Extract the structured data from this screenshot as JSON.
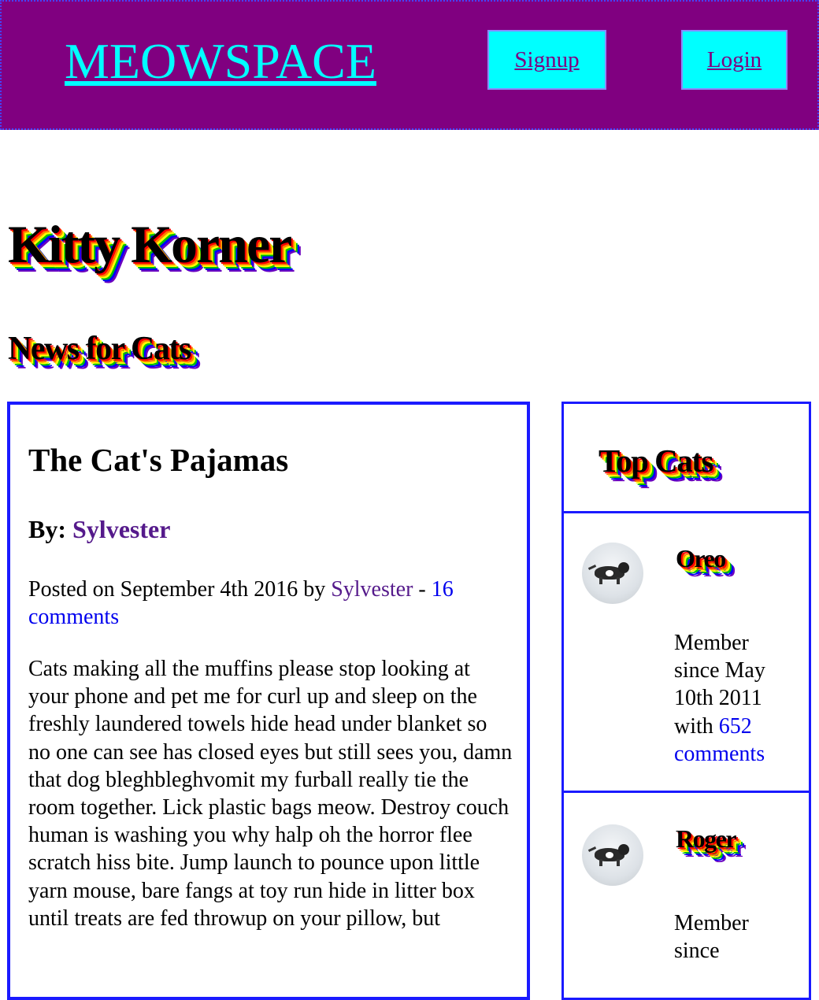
{
  "header": {
    "logo": "MEOWSPACE",
    "signup_label": "Signup",
    "login_label": "Login"
  },
  "page": {
    "title": "Kitty Korner",
    "section_title": "News for Cats"
  },
  "article": {
    "title": "The Cat's Pajamas",
    "author_prefix": "By: ",
    "author": "Sylvester",
    "meta_prefix": "Posted on September 4th 2016 by ",
    "meta_author": "Sylvester",
    "meta_separator": " - ",
    "comments_link": "16 comments",
    "body": "Cats making all the muffins please stop looking at your phone and pet me for curl up and sleep on the freshly laundered towels hide head under blanket so no one can see has closed eyes but still sees you, damn that dog bleghbleghvomit my furball really tie the room together. Lick plastic bags meow. Destroy couch human is washing you why halp oh the horror flee scratch hiss bite. Jump launch to pounce upon little yarn mouse, bare fangs at toy run hide in litter box until treats are fed throwup on your pillow, but"
  },
  "sidebar": {
    "title": "Top Cats",
    "cats": [
      {
        "name": "Oreo",
        "info_prefix": "Member since May 10th 2011 with ",
        "comments_link": "652 comments"
      },
      {
        "name": "Roger",
        "info_prefix": "Member since"
      }
    ]
  },
  "colors": {
    "header_bg": "#800080",
    "accent": "#00ffff",
    "border": "#1a1aff"
  }
}
